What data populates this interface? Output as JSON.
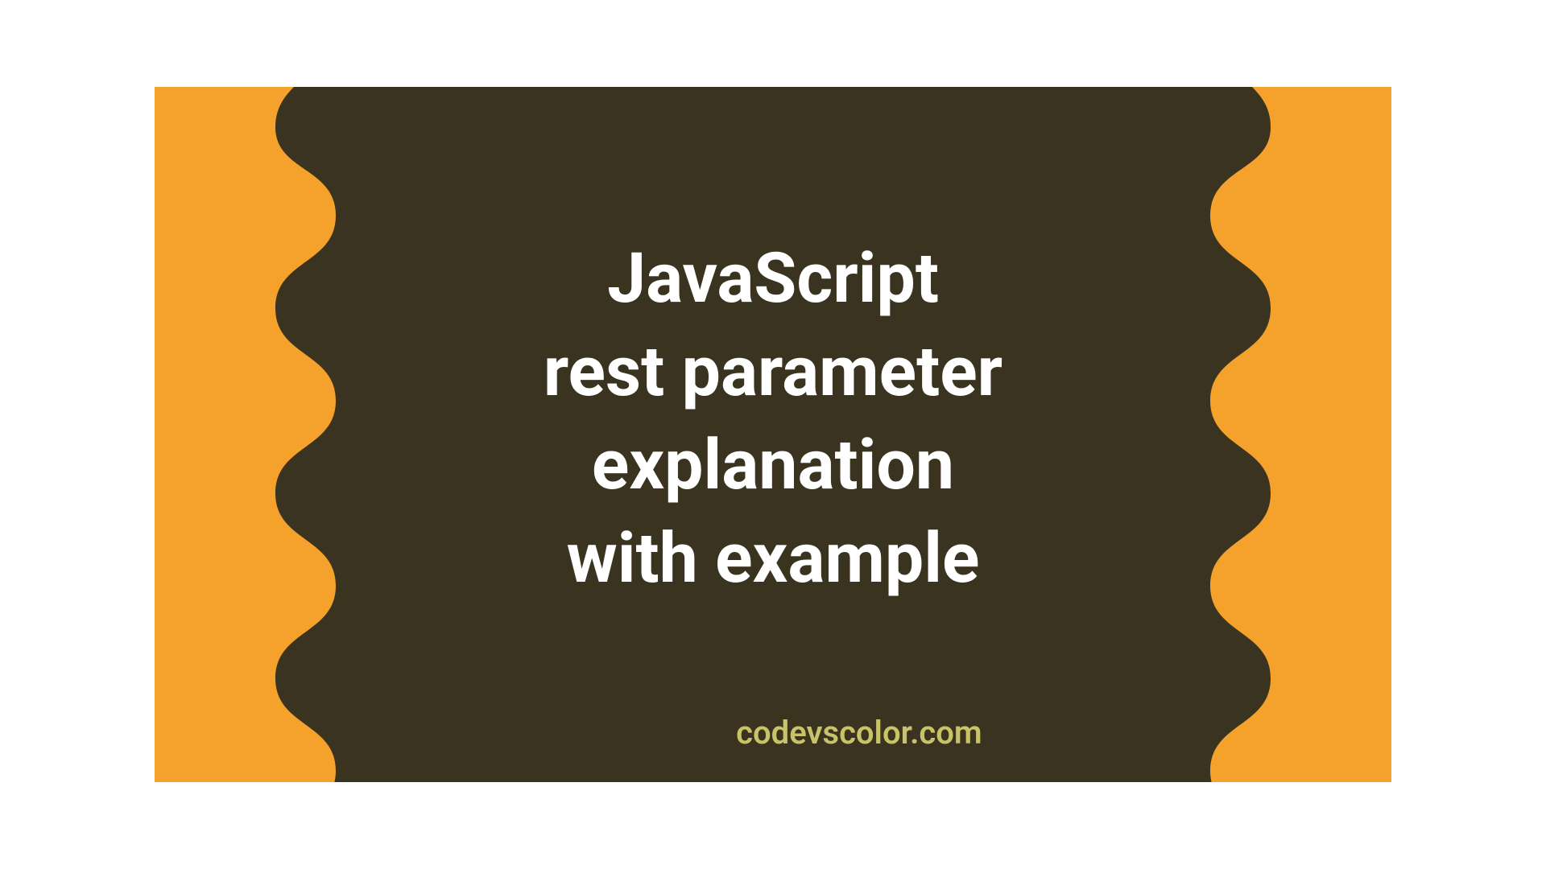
{
  "title": {
    "line1": "JavaScript",
    "line2": "rest parameter",
    "line3": "explanation",
    "line4": "with example"
  },
  "attribution": "codevscolor.com",
  "colors": {
    "background": "#F5A22D",
    "blob": "#3A3320",
    "title": "#FFFFFF",
    "attribution": "#C8C368"
  }
}
